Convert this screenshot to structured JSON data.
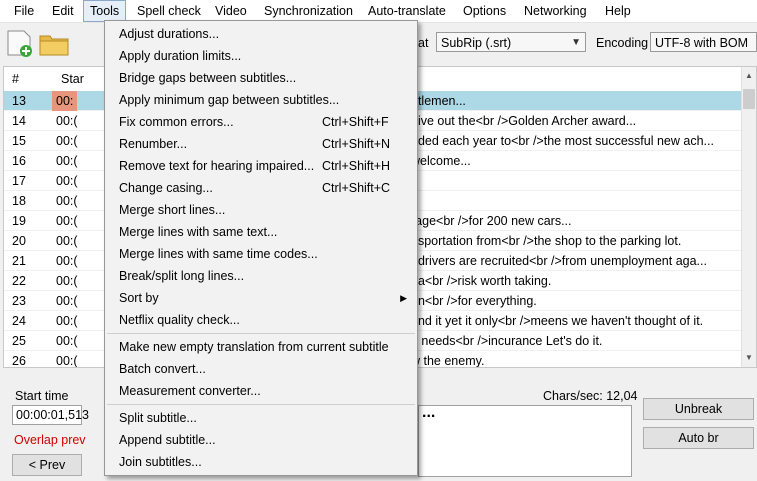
{
  "menubar": {
    "items": [
      {
        "label": "File",
        "name": "menu-file"
      },
      {
        "label": "Edit",
        "name": "menu-edit"
      },
      {
        "label": "Tools",
        "name": "menu-tools"
      },
      {
        "label": "Spell check",
        "name": "menu-spell-check"
      },
      {
        "label": "Video",
        "name": "menu-video"
      },
      {
        "label": "Synchronization",
        "name": "menu-synchronization"
      },
      {
        "label": "Auto-translate",
        "name": "menu-auto-translate"
      },
      {
        "label": "Options",
        "name": "menu-options"
      },
      {
        "label": "Networking",
        "name": "menu-networking"
      },
      {
        "label": "Help",
        "name": "menu-help"
      }
    ]
  },
  "toolbar": {
    "format_label": "at",
    "format_value": "SubRip (.srt)",
    "encoding_label": "Encoding",
    "encoding_value": "UTF-8 with BOM"
  },
  "grid": {
    "col_number": "#",
    "col_start": "Star",
    "rows": [
      {
        "num": "13",
        "start": "00:",
        "text": "ntlemen...",
        "selected": true
      },
      {
        "num": "14",
        "start": "00:(",
        "text": "give out the<br />Golden Archer award..."
      },
      {
        "num": "15",
        "start": "00:(",
        "text": "nded each year to<br />the most successful new ach..."
      },
      {
        "num": "16",
        "start": "00:(",
        "text": "welcome..."
      },
      {
        "num": "17",
        "start": "00:(",
        "text": ""
      },
      {
        "num": "18",
        "start": "00:(",
        "text": ""
      },
      {
        "num": "19",
        "start": "00:(",
        "text": "rage<br />for 200 new cars..."
      },
      {
        "num": "20",
        "start": "00:(",
        "text": "nsportation from<br />the shop to the parking lot."
      },
      {
        "num": "21",
        "start": "00:(",
        "text": ", drivers are recruited<br />from unemployment aga..."
      },
      {
        "num": "22",
        "start": "00:(",
        "text": "t a<br />risk worth taking."
      },
      {
        "num": "23",
        "start": "00:(",
        "text": "on<br />for everything."
      },
      {
        "num": "24",
        "start": "00:(",
        "text": "und it yet it only<br />meens we haven't thought of it."
      },
      {
        "num": "25",
        "start": "00:(",
        "text": "e needs<br />incurance Let's do it."
      },
      {
        "num": "26",
        "start": "00:(",
        "text": "w the enemy."
      }
    ]
  },
  "editor": {
    "start_time_label": "Start time",
    "start_time_value": "00:00:01,513",
    "overlap_text": "Overlap prev",
    "prev_button": "< Prev",
    "chars_sec": "Chars/sec: 12,04",
    "text_preview": "...",
    "unbreak_button": "Unbreak",
    "auto_br_button": "Auto br"
  },
  "tools_menu": {
    "items": [
      {
        "label": "Adjust durations...",
        "shortcut": "",
        "name": "menu-item-adjust-durations"
      },
      {
        "label": "Apply duration limits...",
        "shortcut": "",
        "name": "menu-item-apply-duration-limits"
      },
      {
        "label": "Bridge gaps between subtitles...",
        "shortcut": "",
        "name": "menu-item-bridge-gaps"
      },
      {
        "label": "Apply minimum gap between subtitles...",
        "shortcut": "",
        "name": "menu-item-apply-minimum-gap"
      },
      {
        "label": "Fix common errors...",
        "shortcut": "Ctrl+Shift+F",
        "name": "menu-item-fix-common-errors"
      },
      {
        "label": "Renumber...",
        "shortcut": "Ctrl+Shift+N",
        "name": "menu-item-renumber"
      },
      {
        "label": "Remove text for hearing impaired...",
        "shortcut": "Ctrl+Shift+H",
        "name": "menu-item-remove-text-hi"
      },
      {
        "label": "Change casing...",
        "shortcut": "Ctrl+Shift+C",
        "name": "menu-item-change-casing"
      },
      {
        "label": "Merge short lines...",
        "shortcut": "",
        "name": "menu-item-merge-short-lines"
      },
      {
        "label": "Merge lines with same text...",
        "shortcut": "",
        "name": "menu-item-merge-same-text"
      },
      {
        "label": "Merge lines with same time codes...",
        "shortcut": "",
        "name": "menu-item-merge-same-time-codes"
      },
      {
        "label": "Break/split long lines...",
        "shortcut": "",
        "name": "menu-item-break-split-long-lines"
      },
      {
        "label": "Sort by",
        "shortcut": "",
        "submenu": true,
        "name": "menu-item-sort-by"
      },
      {
        "label": "Netflix quality check...",
        "shortcut": "",
        "name": "menu-item-netflix-quality-check"
      },
      {
        "separator": true
      },
      {
        "label": "Make new empty translation from current subtitle",
        "shortcut": "",
        "name": "menu-item-make-empty-translation"
      },
      {
        "label": "Batch convert...",
        "shortcut": "",
        "name": "menu-item-batch-convert"
      },
      {
        "label": "Measurement converter...",
        "shortcut": "",
        "name": "menu-item-measurement-converter"
      },
      {
        "separator": true
      },
      {
        "label": "Split subtitle...",
        "shortcut": "",
        "name": "menu-item-split-subtitle"
      },
      {
        "label": "Append subtitle...",
        "shortcut": "",
        "name": "menu-item-append-subtitle"
      },
      {
        "label": "Join subtitles...",
        "shortcut": "",
        "name": "menu-item-join-subtitles"
      }
    ]
  },
  "icons": {
    "new": "new-file-icon",
    "open": "open-folder-icon",
    "submenu": "submenu-arrow-icon"
  }
}
